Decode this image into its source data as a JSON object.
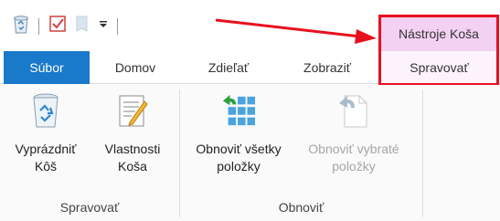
{
  "quick_access": {
    "icons": [
      "recycle-bin-icon",
      "properties-checkbox-icon",
      "folder-icon",
      "customize-dropdown-icon"
    ]
  },
  "contextual": {
    "header": "Nástroje Koša",
    "tab": "Spravovať",
    "highlight_color": "#e8101e",
    "header_color": "#f3d1f3"
  },
  "tabs": {
    "file": "Súbor",
    "home": "Domov",
    "share": "Zdieľať",
    "view": "Zobraziť",
    "file_color": "#1979ca"
  },
  "ribbon": {
    "groups": [
      {
        "label": "Spravovať",
        "commands": [
          {
            "label": "Vyprázdniť\nKôš",
            "icon": "recycle-bin-icon",
            "enabled": true
          },
          {
            "label": "Vlastnosti\nKoša",
            "icon": "properties-icon",
            "enabled": true
          }
        ]
      },
      {
        "label": "Obnoviť",
        "commands": [
          {
            "label": "Obnoviť všetky\npoložky",
            "icon": "restore-all-icon",
            "enabled": true
          },
          {
            "label": "Obnoviť vybraté\npoložky",
            "icon": "restore-selected-icon",
            "enabled": false
          }
        ]
      }
    ]
  }
}
